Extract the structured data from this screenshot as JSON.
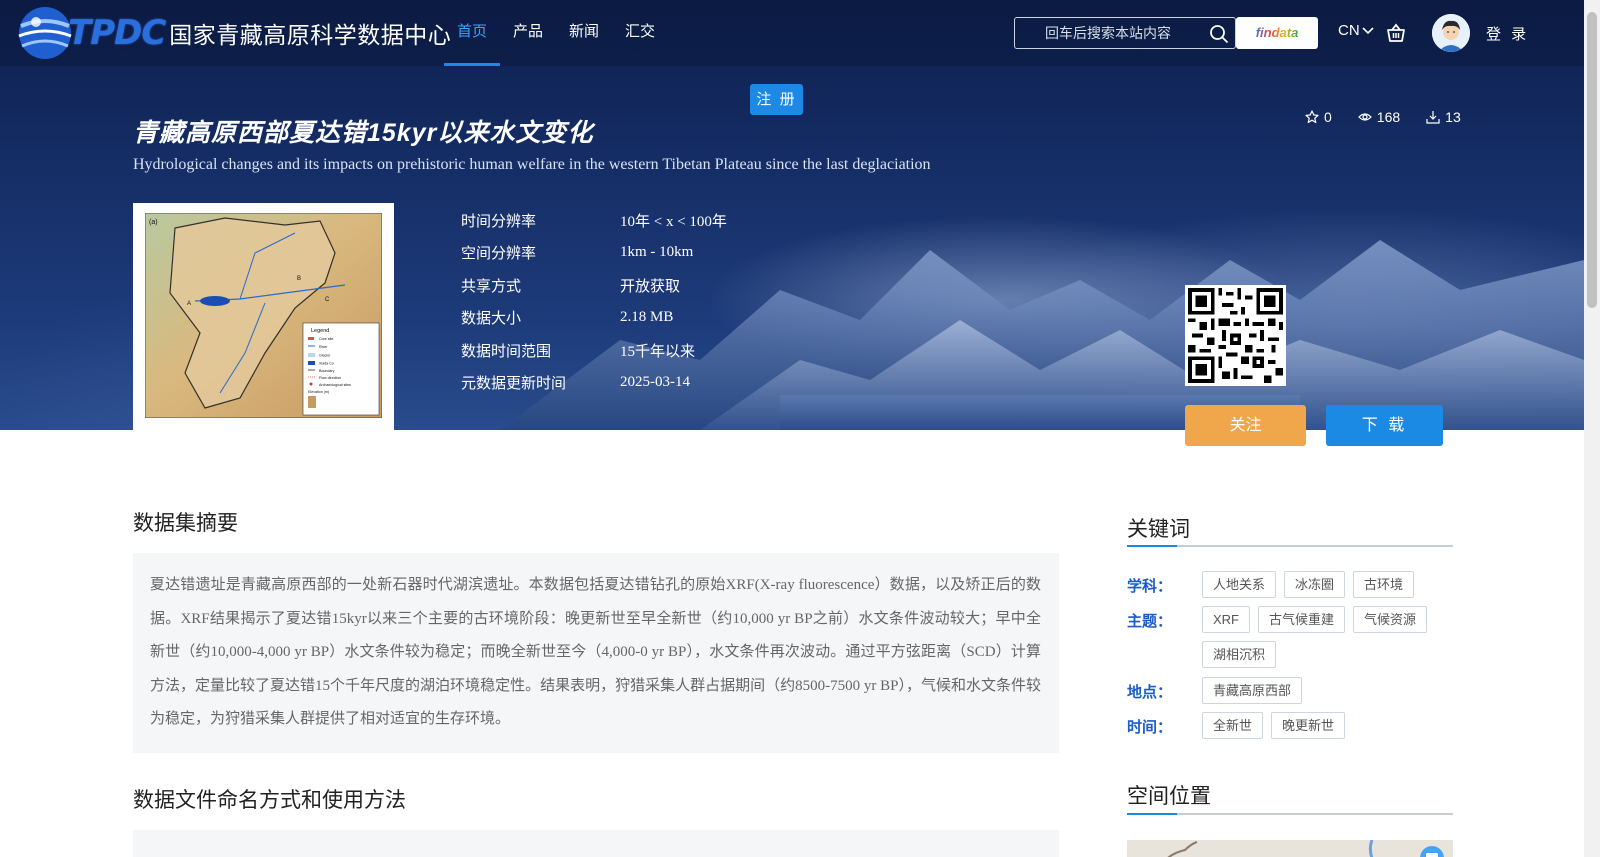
{
  "header": {
    "logo_abbr": "TPDC",
    "logo_name": "国家青藏高原科学数据中心",
    "nav": [
      {
        "label": "首页",
        "active": true
      },
      {
        "label": "产品",
        "active": false
      },
      {
        "label": "新闻",
        "active": false
      },
      {
        "label": "汇交",
        "active": false
      }
    ],
    "search_placeholder": "回车后搜索本站内容",
    "findata_label": "findata",
    "lang": "CN",
    "login": "登 录",
    "register": "注 册"
  },
  "dataset": {
    "title_cn": "青藏高原西部夏达错15kyr以来水文变化",
    "title_en": "Hydrological changes and its impacts on prehistoric human welfare in the western Tibetan Plateau since the last deglaciation",
    "stats": {
      "favorites": "0",
      "views": "168",
      "downloads": "13"
    },
    "meta": [
      {
        "key": "时间分辨率",
        "value": "10年 < x < 100年"
      },
      {
        "key": "空间分辨率",
        "value": "1km - 10km"
      },
      {
        "key": "共享方式",
        "value": "开放获取"
      },
      {
        "key": "数据大小",
        "value": "2.18 MB"
      },
      {
        "key": "数据时间范围",
        "value": "15千年以来"
      },
      {
        "key": "元数据更新时间",
        "value": "2025-03-14"
      }
    ],
    "follow_label": "关注",
    "download_label": "下 载"
  },
  "thumbnail": {
    "panel_label": "(a)",
    "point_labels": [
      "A",
      "B",
      "C"
    ],
    "legend_title": "Legend",
    "legend_items": [
      "Core site",
      "River",
      "Glacier",
      "Xiada Co",
      "Boundary",
      "Flow direction",
      "Archaeological sites",
      "Elevation (m)"
    ]
  },
  "abstract": {
    "title": "数据集摘要",
    "text": "夏达错遗址是青藏高原西部的一处新石器时代湖滨遗址。本数据包括夏达错钻孔的原始XRF(X-ray fluorescence）数据，以及矫正后的数据。XRF结果揭示了夏达错15kyr以来三个主要的古环境阶段：晚更新世至早全新世（约10,000 yr BP之前）水文条件波动较大；早中全新世（约10,000-4,000 yr BP）水文条件较为稳定；而晚全新世至今（4,000-0 yr BP），水文条件再次波动。通过平方弦距离（SCD）计算方法，定量比较了夏达错15个千年尺度的湖泊环境稳定性。结果表明，狩猎采集人群占据期间（约8500-7500 yr BP），气候和水文条件较为稳定，为狩猎采集人群提供了相对适宜的生存环境。"
  },
  "naming": {
    "title": "数据文件命名方式和使用方法"
  },
  "keywords": {
    "title": "关键词",
    "groups": [
      {
        "label": "学科：",
        "tags": [
          "人地关系",
          "冰冻圈",
          "古环境"
        ]
      },
      {
        "label": "主题：",
        "tags": [
          "XRF",
          "古气候重建",
          "气候资源",
          "湖相沉积"
        ]
      },
      {
        "label": "地点：",
        "tags": [
          "青藏高原西部"
        ]
      },
      {
        "label": "时间：",
        "tags": [
          "全新世",
          "晚更新世"
        ]
      }
    ]
  },
  "spatial": {
    "title": "空间位置"
  },
  "colors": {
    "accent_blue": "#1e88e5",
    "follow_orange": "#f0a64a",
    "keyword_label": "#1a5cc9",
    "hero_dark": "#0d1f4d"
  }
}
